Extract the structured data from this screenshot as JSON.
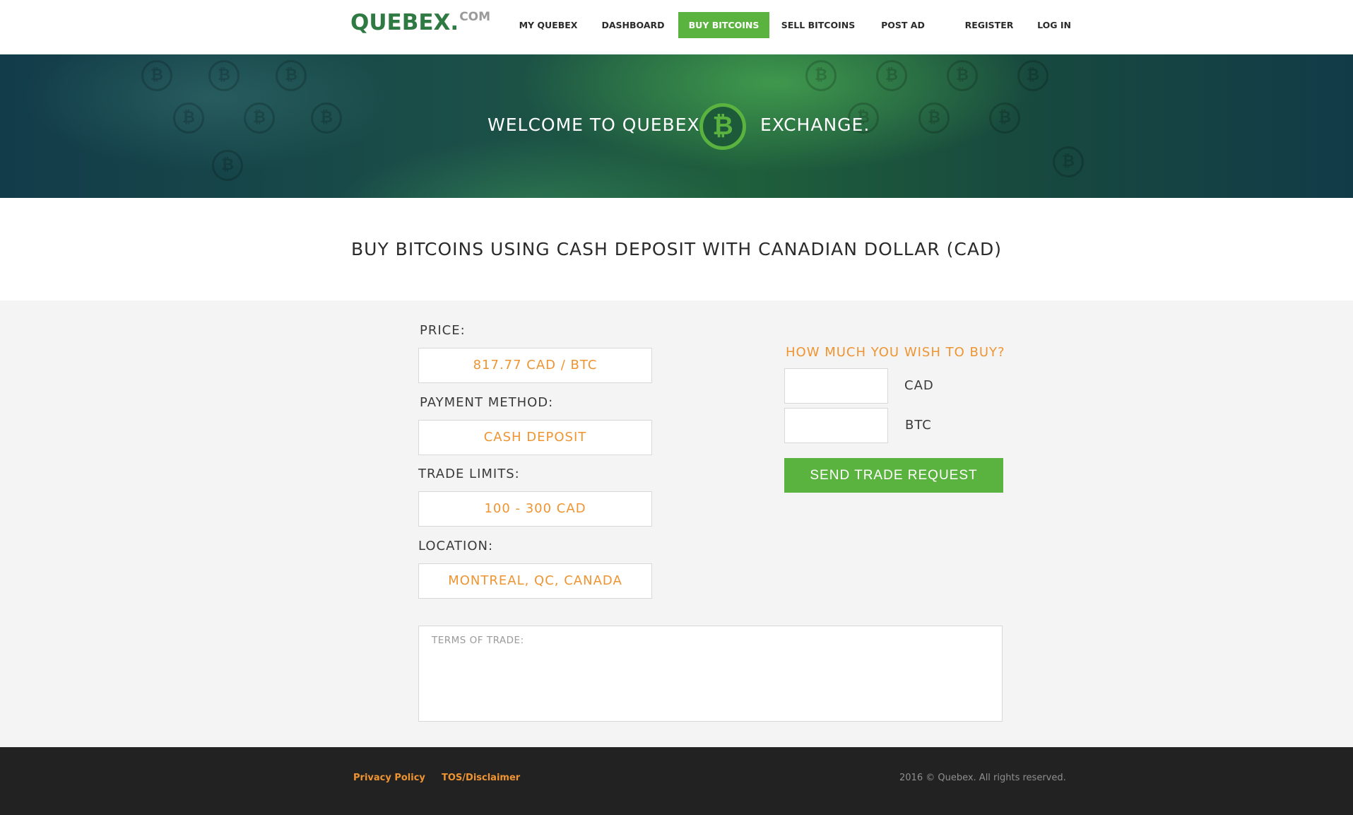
{
  "header": {
    "logo": "QUEBEX.",
    "logo_suffix": "COM",
    "nav": [
      {
        "label": "MY QUEBEX"
      },
      {
        "label": "DASHBOARD"
      },
      {
        "label": "BUY BITCOINS",
        "active": true
      },
      {
        "label": "SELL BITCOINS"
      },
      {
        "label": "POST AD"
      },
      {
        "label": "REGISTER"
      },
      {
        "label": "LOG IN"
      }
    ]
  },
  "hero": {
    "welcome": "WELCOME TO QUEBEX",
    "exchange": "EXCHANGE.",
    "logo_icon": "bitcoin-logo-icon",
    "logo_glyph": "₿"
  },
  "page_title": "BUY BITCOINS USING CASH DEPOSIT WITH CANADIAN DOLLAR (CAD)",
  "details": {
    "price_label": "PRICE:",
    "price_value": "817.77 CAD / BTC",
    "payment_label": "PAYMENT METHOD:",
    "payment_value": "CASH DEPOSIT",
    "limits_label": "TRADE LIMITS:",
    "limits_value": "100 - 300 CAD",
    "location_label": "LOCATION:",
    "location_value": "MONTREAL, QC, CANADA"
  },
  "buy": {
    "title": "HOW MUCH YOU WISH TO BUY?",
    "cad_value": "",
    "cad_unit": "CAD",
    "btc_value": "",
    "btc_unit": "BTC",
    "send_button": "SEND TRADE REQUEST"
  },
  "terms": {
    "label": "TERMS OF TRADE:"
  },
  "footer": {
    "privacy": "Privacy Policy",
    "tos": "TOS/Disclaimer",
    "copyright": "2016 © Quebex. All rights reserved."
  },
  "colors": {
    "brand_green": "#5bb33f",
    "logo_green": "#2f7a43",
    "accent_orange": "#ef9431",
    "footer_bg": "#222222"
  }
}
